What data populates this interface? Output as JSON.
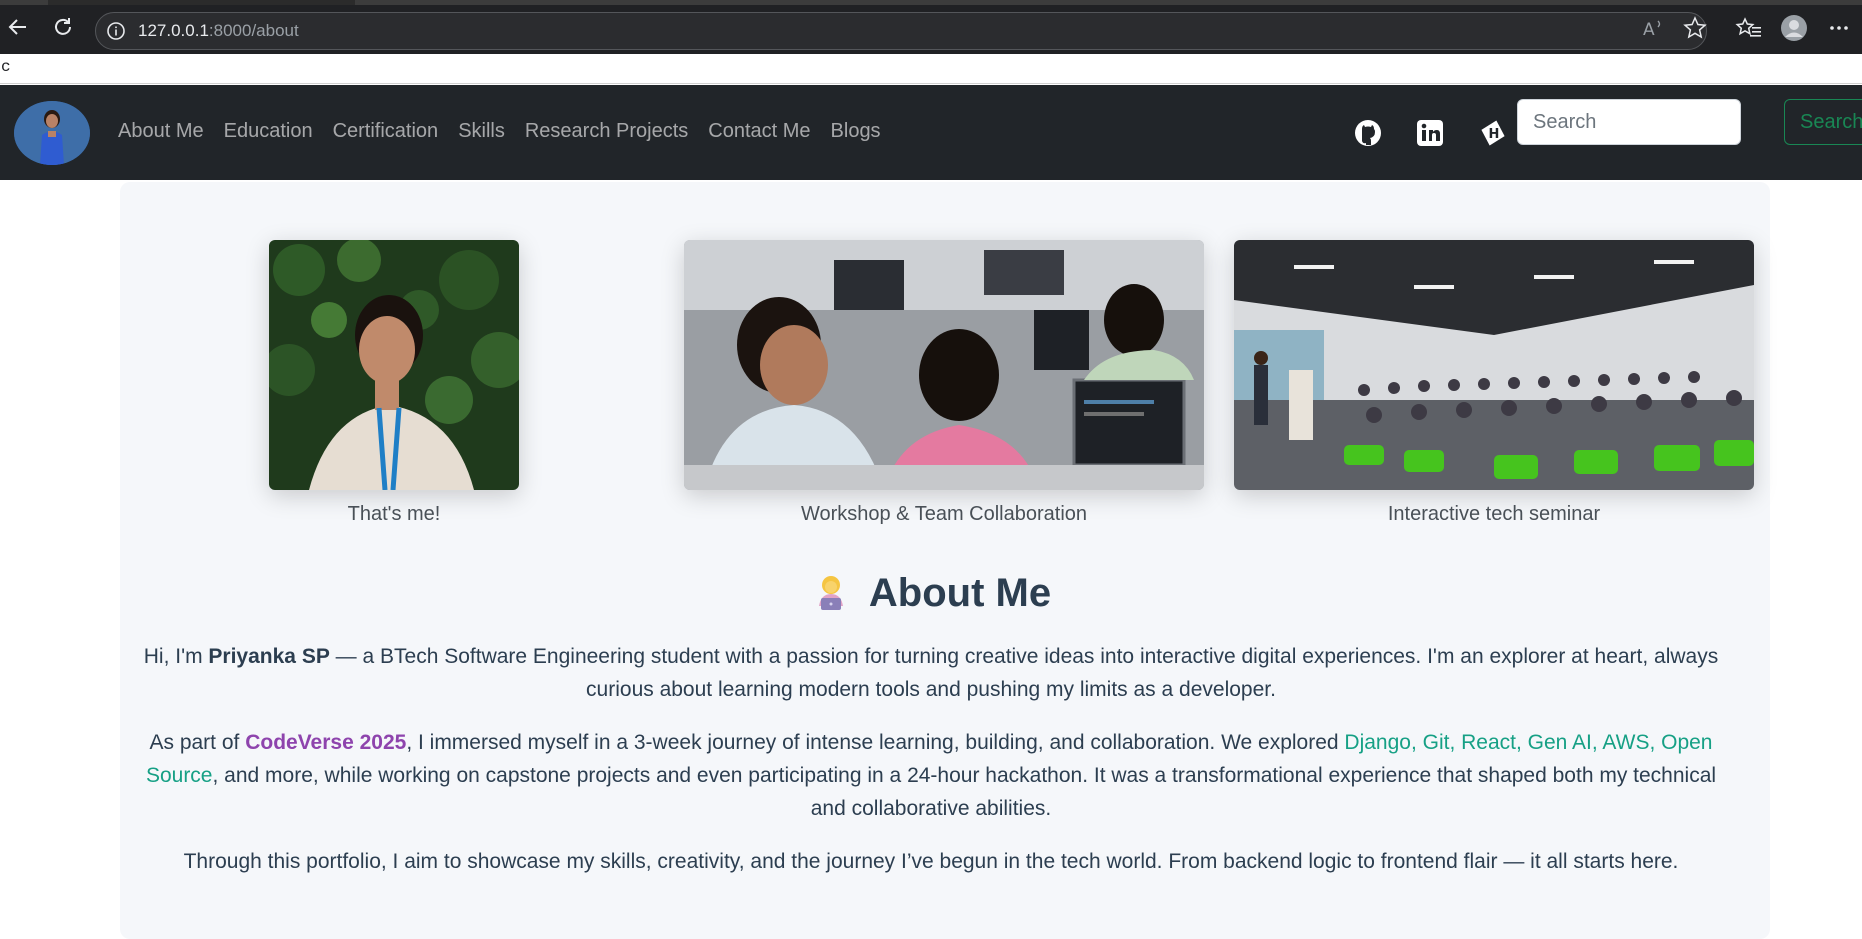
{
  "browser": {
    "url_host": "127.0.0.1",
    "url_path": ":8000/about",
    "find_text": "c"
  },
  "navbar": {
    "links": [
      "About Me",
      "Education",
      "Certification",
      "Skills",
      "Research Projects",
      "Contact Me",
      "Blogs"
    ],
    "social_icons": [
      "github-icon",
      "linkedin-icon",
      "hashnode-icon"
    ],
    "search": {
      "placeholder": "Search",
      "button_label": "Search"
    }
  },
  "gallery": [
    {
      "caption": "That's me!"
    },
    {
      "caption": "Workshop & Team Collaboration"
    },
    {
      "caption": "Interactive tech seminar"
    }
  ],
  "about": {
    "title": "About Me",
    "title_icon": "technologist-emoji",
    "p1": {
      "before": "Hi, I'm ",
      "name": "Priyanka SP",
      "after": " — a BTech Software Engineering student with a passion for turning creative ideas into interactive digital experiences. I'm an explorer at heart, always curious about learning modern tools and pushing my limits as a developer."
    },
    "p2": {
      "before": "As part of ",
      "event": "CodeVerse 2025",
      "middle": ", I immersed myself in a 3-week journey of intense learning, building, and collaboration. We explored ",
      "techs": "Django, Git, React, Gen AI, AWS, Open Source",
      "after": ", and more, while working on capstone projects and even participating in a 24-hour hackathon. It was a transformational experience that shaped both my technical and collaborative abilities."
    },
    "p3": "Through this portfolio, I aim to showcase my skills, creativity, and the journey I’ve begun in the tech world. From backend logic to frontend flair — it all starts here."
  },
  "colors": {
    "navbar_bg": "#212529",
    "content_bg": "#f5f7fa",
    "heading": "#2c3e50",
    "event_accent": "#8e44ad",
    "tech_accent": "#16a085",
    "search_button": "#198754"
  }
}
